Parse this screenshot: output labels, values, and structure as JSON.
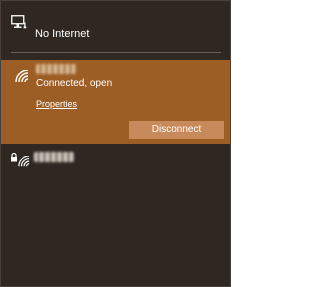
{
  "header": {
    "icon": "network-pc-icon",
    "status": "No Internet"
  },
  "active_network": {
    "icon": "wifi-icon",
    "name": "",
    "status": "Connected, open",
    "properties_label": "Properties",
    "disconnect_label": "Disconnect",
    "color": "#9c5e25",
    "button_color": "#c88a5a"
  },
  "other_networks": [
    {
      "icon": "wifi-icon",
      "secured": true,
      "lock_icon": "lock-icon",
      "name": ""
    }
  ],
  "colors": {
    "background": "#2f2822",
    "text": "#ffffff"
  }
}
